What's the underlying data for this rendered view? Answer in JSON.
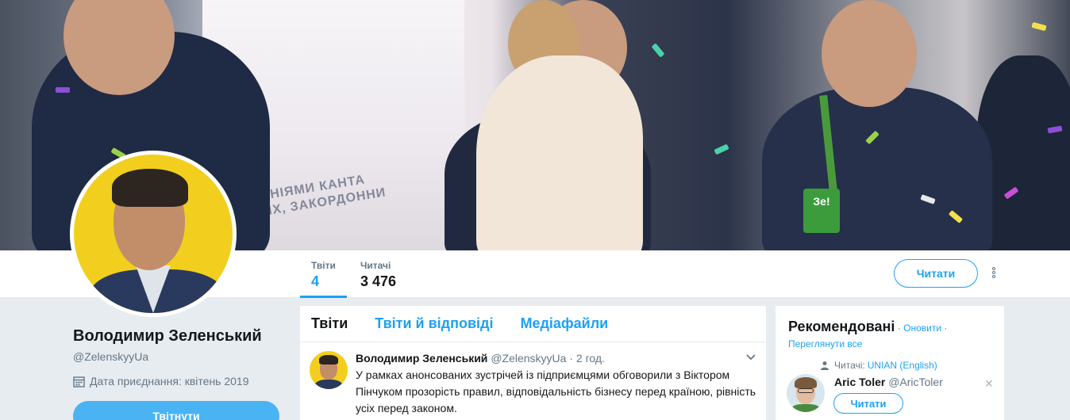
{
  "stats": [
    {
      "label": "Твіти",
      "value": "4"
    },
    {
      "label": "Читачі",
      "value": "3 476"
    }
  ],
  "follow_button": "Читати",
  "banner": {
    "screen_text_1": "...ПАНІЯМИ КАНТА",
    "screen_text_2": "...НИХ, ЗАКОРДОННИ",
    "badge_text": "Зе!"
  },
  "profile": {
    "name": "Володимир Зеленський",
    "handle": "@ZelenskyyUa",
    "joined": "Дата приєднання: квітень 2019",
    "tweet_to_button": "Твітнути"
  },
  "timeline": {
    "tabs": [
      {
        "label": "Твіти",
        "active": true
      },
      {
        "label": "Твіти й відповіді",
        "active": false
      },
      {
        "label": "Медіафайли",
        "active": false
      }
    ],
    "tweet": {
      "name": "Володимир Зеленський",
      "handle": "@ZelenskyyUa",
      "time": "· 2 год.",
      "text": "У рамках анонсованих зустрічей із підприємцями обговорили з Віктором Пінчуком прозорість правил, відповідальність бізнесу перед країною, рівність усіх перед законом."
    }
  },
  "who_to_follow": {
    "title": "Рекомендовані",
    "sep1": " · ",
    "refresh": "Оновити",
    "sep2": " ·",
    "view_all": "Переглянути все",
    "context_label": "Читачі:",
    "context_user": "UNIAN (English)",
    "user_name": "Aric Toler",
    "user_handle": "@AricToler",
    "follow_label": "Читати",
    "dismiss": "✕"
  }
}
